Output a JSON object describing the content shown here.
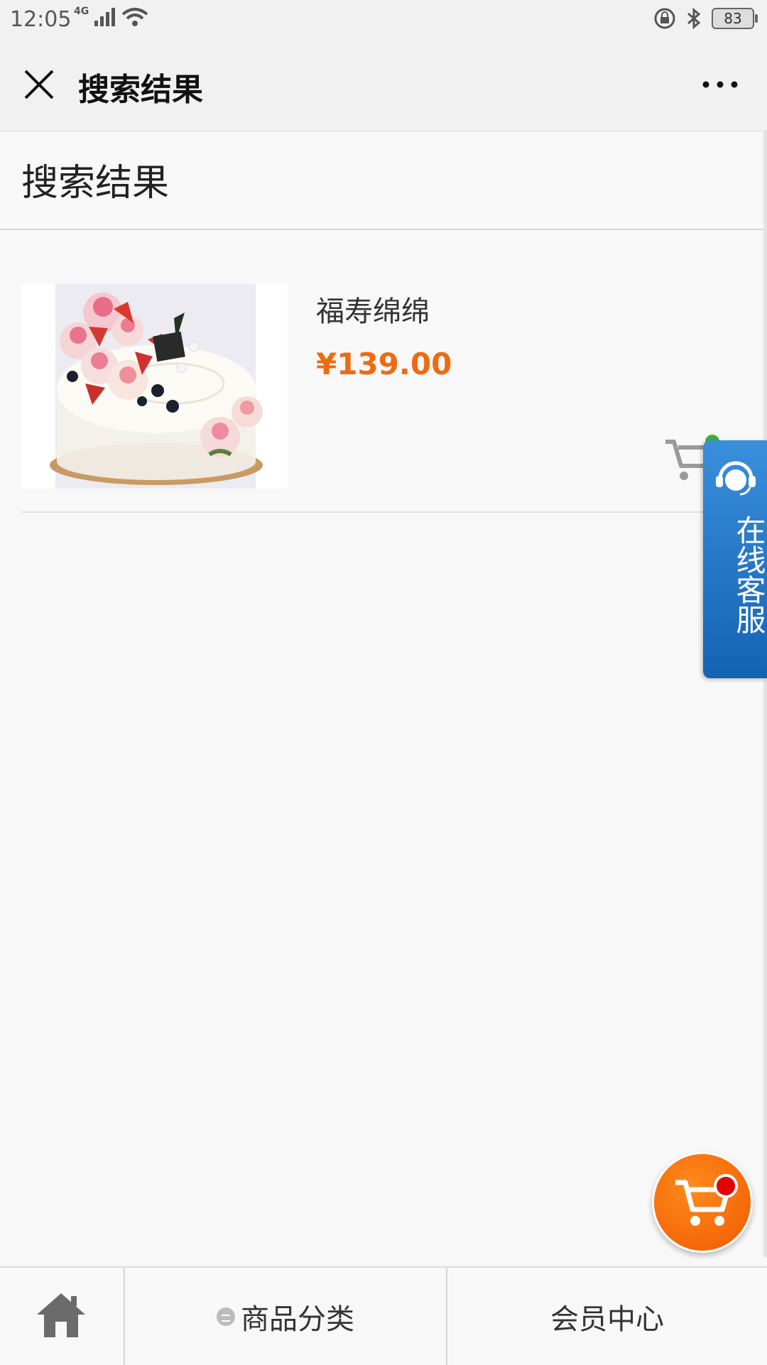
{
  "status_bar": {
    "time": "12:05",
    "network": "4G",
    "battery": "83"
  },
  "title_bar": {
    "title": "搜索结果"
  },
  "page": {
    "header": "搜索结果"
  },
  "products": [
    {
      "name": "福寿绵绵",
      "price": "¥139.00"
    }
  ],
  "service": {
    "label": "在线客服"
  },
  "bottom_nav": {
    "category": "商品分类",
    "member": "会员中心"
  },
  "colors": {
    "price": "#ef6a10",
    "service_blue": "#1463b3",
    "cart_orange": "#f05a00"
  }
}
